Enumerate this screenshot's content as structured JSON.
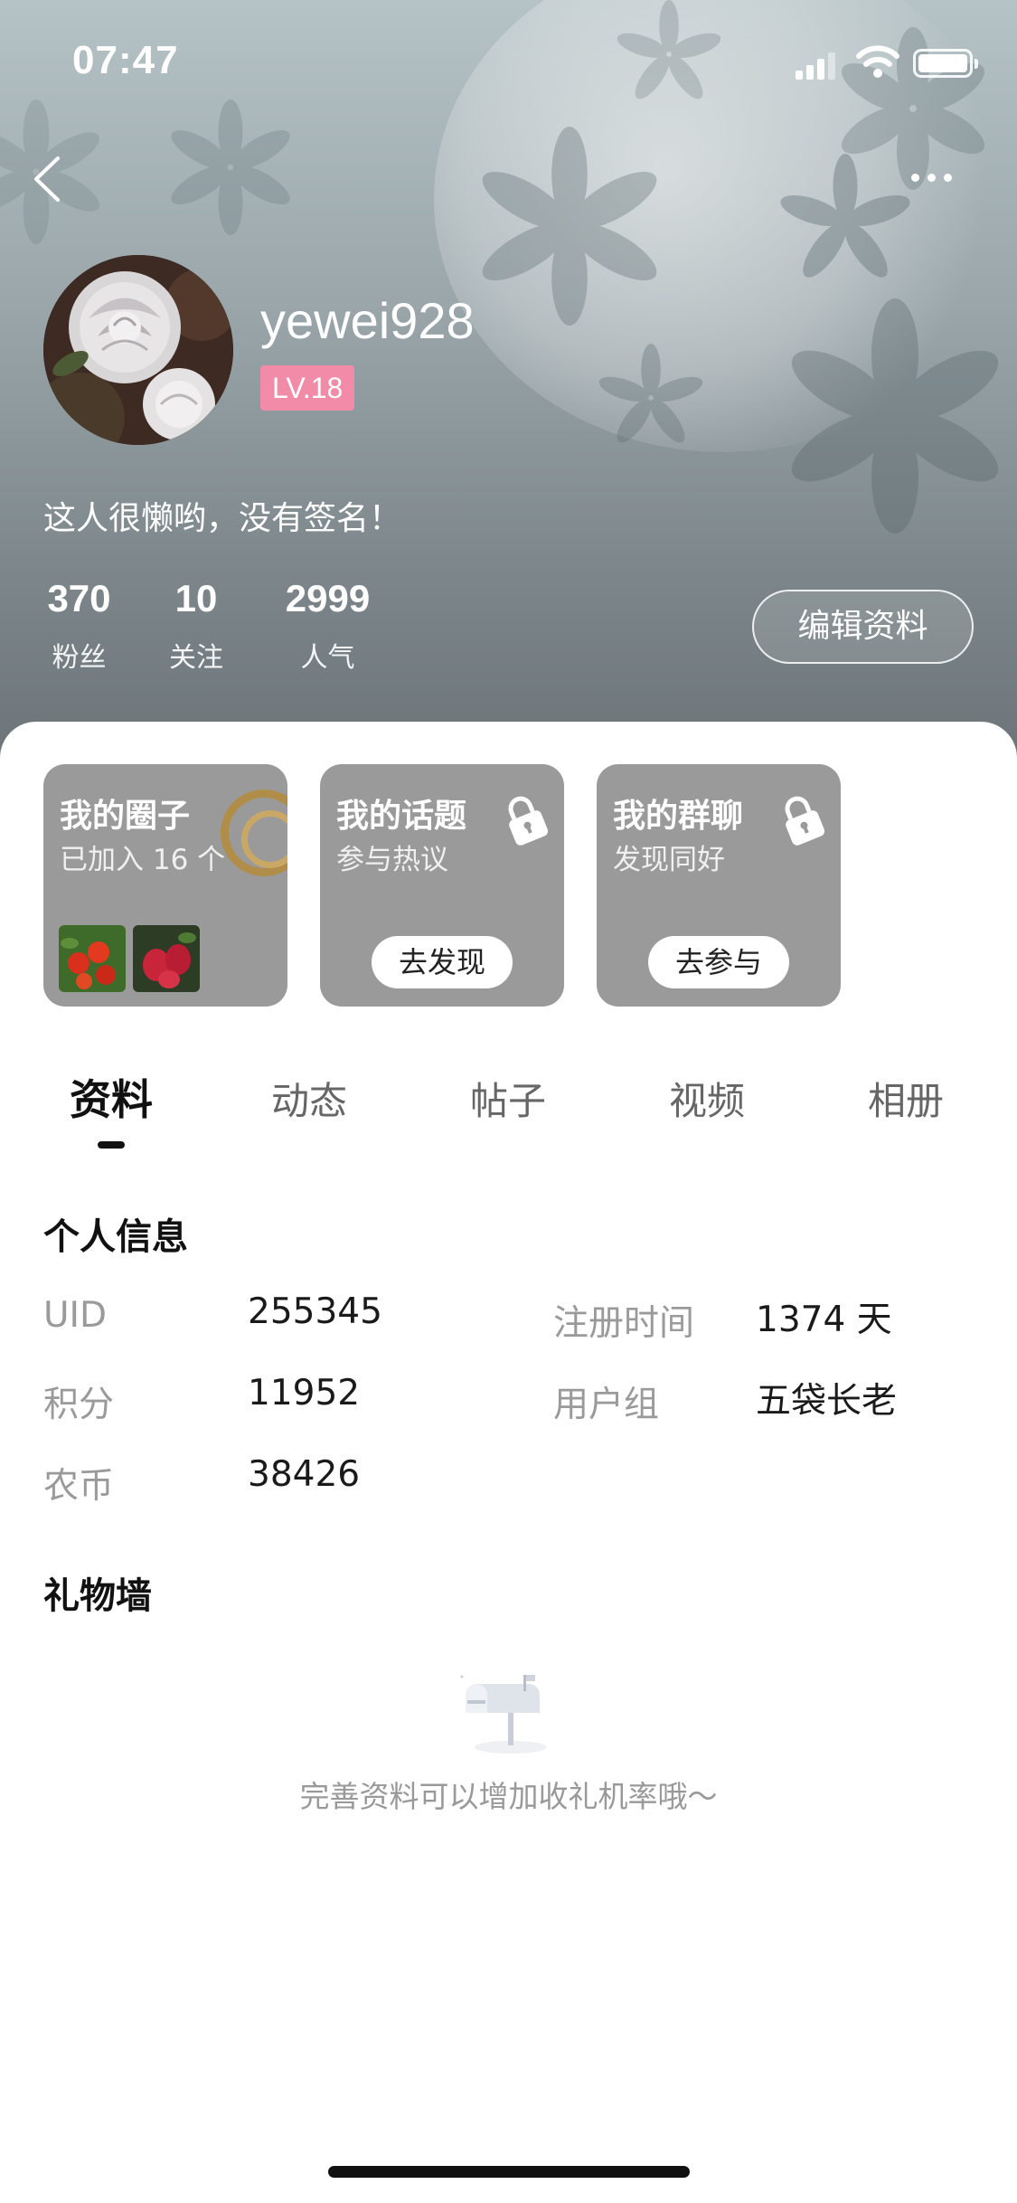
{
  "status_bar": {
    "time": "07:47"
  },
  "profile": {
    "username": "yewei928",
    "level": "LV.18",
    "signature": "这人很懒哟，没有签名！",
    "stats": [
      {
        "value": "370",
        "label": "粉丝"
      },
      {
        "value": "10",
        "label": "关注"
      },
      {
        "value": "2999",
        "label": "人气"
      }
    ],
    "edit_button": "编辑资料"
  },
  "cards": [
    {
      "title": "我的圈子",
      "subtitle": "已加入 16 个",
      "button": ""
    },
    {
      "title": "我的话题",
      "subtitle": "参与热议",
      "button": "去发现"
    },
    {
      "title": "我的群聊",
      "subtitle": "发现同好",
      "button": "去参与"
    }
  ],
  "tabs": [
    "资料",
    "动态",
    "帖子",
    "视频",
    "相册"
  ],
  "active_tab": "资料",
  "personal_info": {
    "title": "个人信息",
    "rows": [
      {
        "label": "UID",
        "value": "255345"
      },
      {
        "label": "注册时间",
        "value": "1374 天"
      },
      {
        "label": "积分",
        "value": "11952"
      },
      {
        "label": "用户组",
        "value": "五袋长老"
      },
      {
        "label": "农币",
        "value": "38426"
      }
    ]
  },
  "gift_wall": {
    "title": "礼物墙",
    "empty_text": "完善资料可以增加收礼机率哦～"
  },
  "colors": {
    "level_badge": "#f28ba8",
    "card_bg": "#9a9a9a",
    "label_gray": "#9a9a9a"
  },
  "icons": [
    "back-icon",
    "more-icon",
    "lock-icon",
    "mailbox-icon",
    "signal-icon",
    "wifi-icon",
    "battery-icon"
  ]
}
